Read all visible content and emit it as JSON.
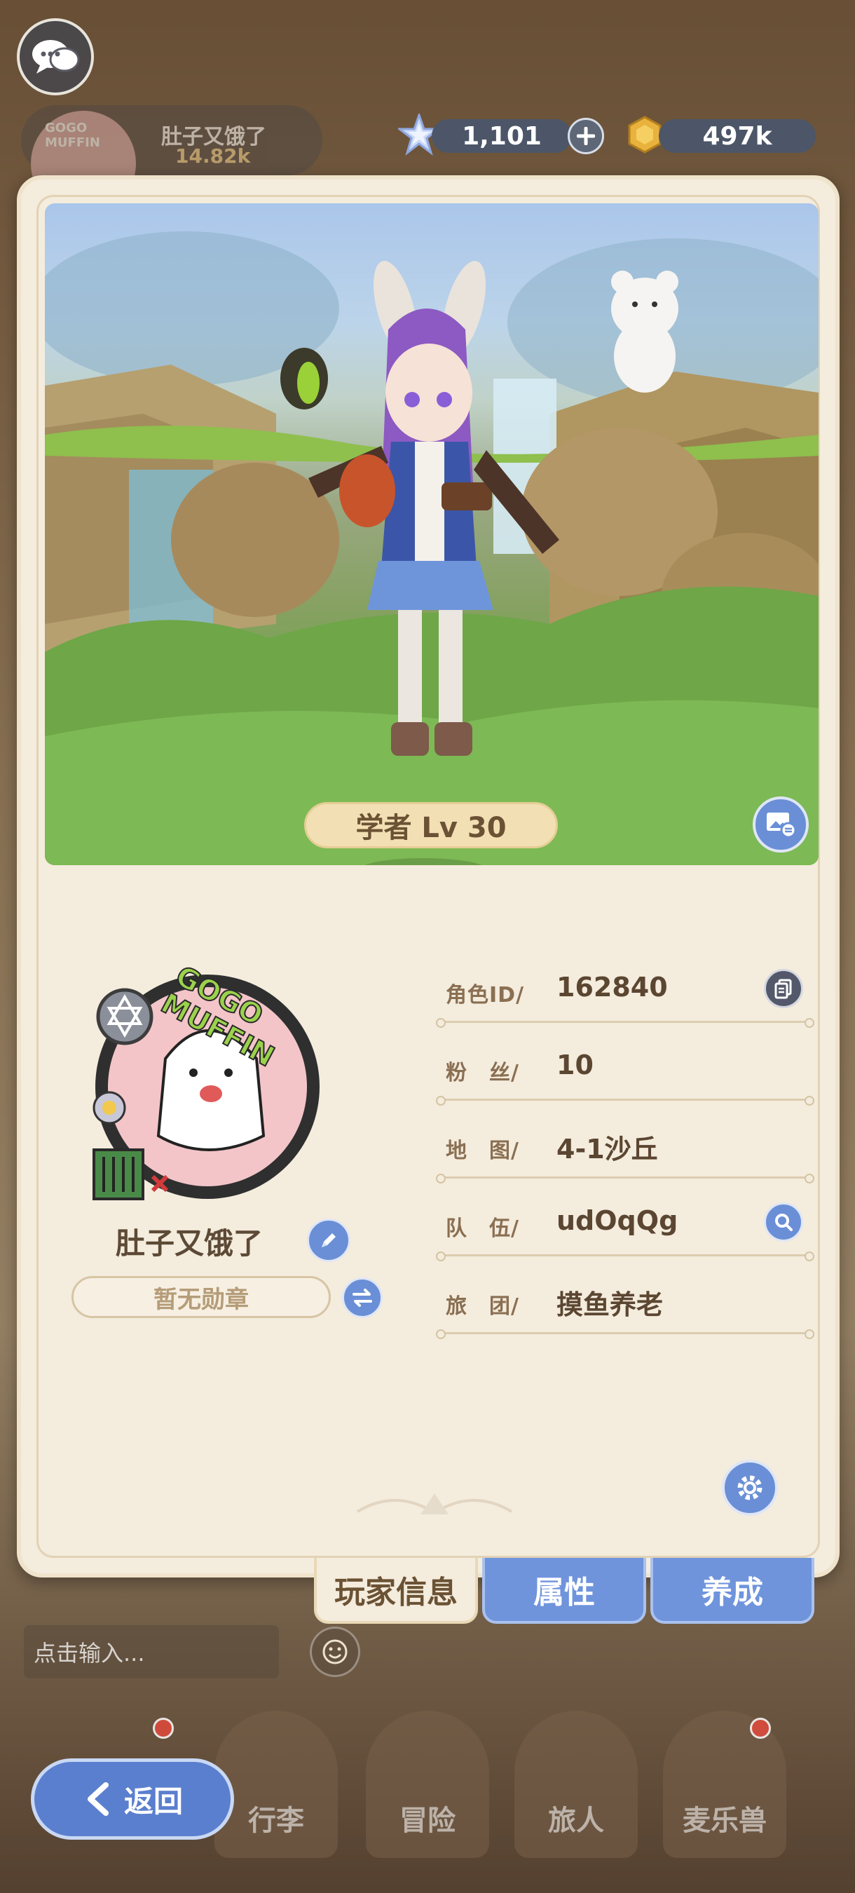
{
  "hud": {
    "player_name": "肚子又饿了",
    "player_power": "14.82k",
    "player_avatar_text": "GOGO MUFFIN",
    "crystals": "1,101",
    "coins": "497k"
  },
  "panel": {
    "class_level": "学者 Lv 30",
    "avatar_text": "GOGO MUFFIN",
    "player_name": "肚子又饿了",
    "medal": "暂无勋章",
    "info": [
      {
        "label": "角色ID/",
        "value": "162840"
      },
      {
        "label": "粉　丝/",
        "value": "10"
      },
      {
        "label": "地　图/",
        "value": "4-1沙丘"
      },
      {
        "label": "队　伍/",
        "value": "udOqQg"
      },
      {
        "label": "旅　团/",
        "value": "摸鱼养老"
      }
    ]
  },
  "tabs": [
    "玩家信息",
    "属性",
    "养成"
  ],
  "chat": {
    "placeholder": "点击输入..."
  },
  "nav": [
    "行李",
    "冒险",
    "旅人",
    "麦乐兽"
  ],
  "back": "返回",
  "colors": {
    "accent_blue": "#6a8fd6",
    "panel_bg": "#f4ecdd",
    "text_brown": "#5b4632"
  }
}
